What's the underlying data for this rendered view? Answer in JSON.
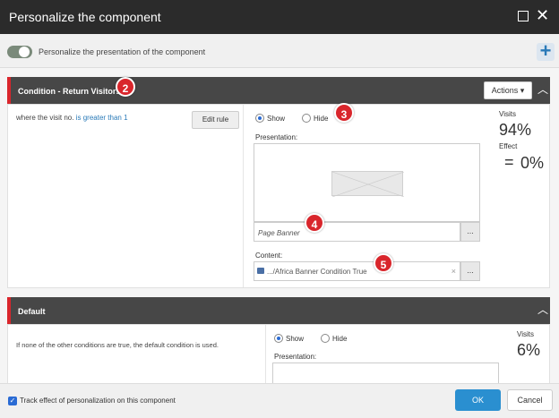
{
  "window": {
    "title": "Personalize the component"
  },
  "toolbar": {
    "label": "Personalize the presentation of the component"
  },
  "conditions": [
    {
      "name": "Condition - Return Visitors",
      "actions_label": "Actions",
      "rule_prefix": "where the visit no.",
      "rule_link": "is greater than 1",
      "edit_label": "Edit rule",
      "show_label": "Show",
      "hide_label": "Hide",
      "presentation_label": "Presentation:",
      "presentation_placeholder": "Page Banner",
      "content_label": "Content:",
      "content_value": ".../Africa Banner Condition True",
      "visits_label": "Visits",
      "visits_value": "94%",
      "effect_label": "Effect",
      "effect_value": "0%",
      "effect_sign": "="
    },
    {
      "name": "Default",
      "rule_text": "If none of the other conditions are true, the default condition is used.",
      "show_label": "Show",
      "hide_label": "Hide",
      "presentation_label": "Presentation:",
      "visits_label": "Visits",
      "visits_value": "6%"
    }
  ],
  "callouts": [
    "2",
    "3",
    "4",
    "5"
  ],
  "footer": {
    "track_label": "Track effect of personalization on this component",
    "ok_label": "OK",
    "cancel_label": "Cancel"
  },
  "colors": {
    "accent_red": "#d9262c",
    "primary_blue": "#2a8fd0",
    "header_dark": "#474747"
  }
}
